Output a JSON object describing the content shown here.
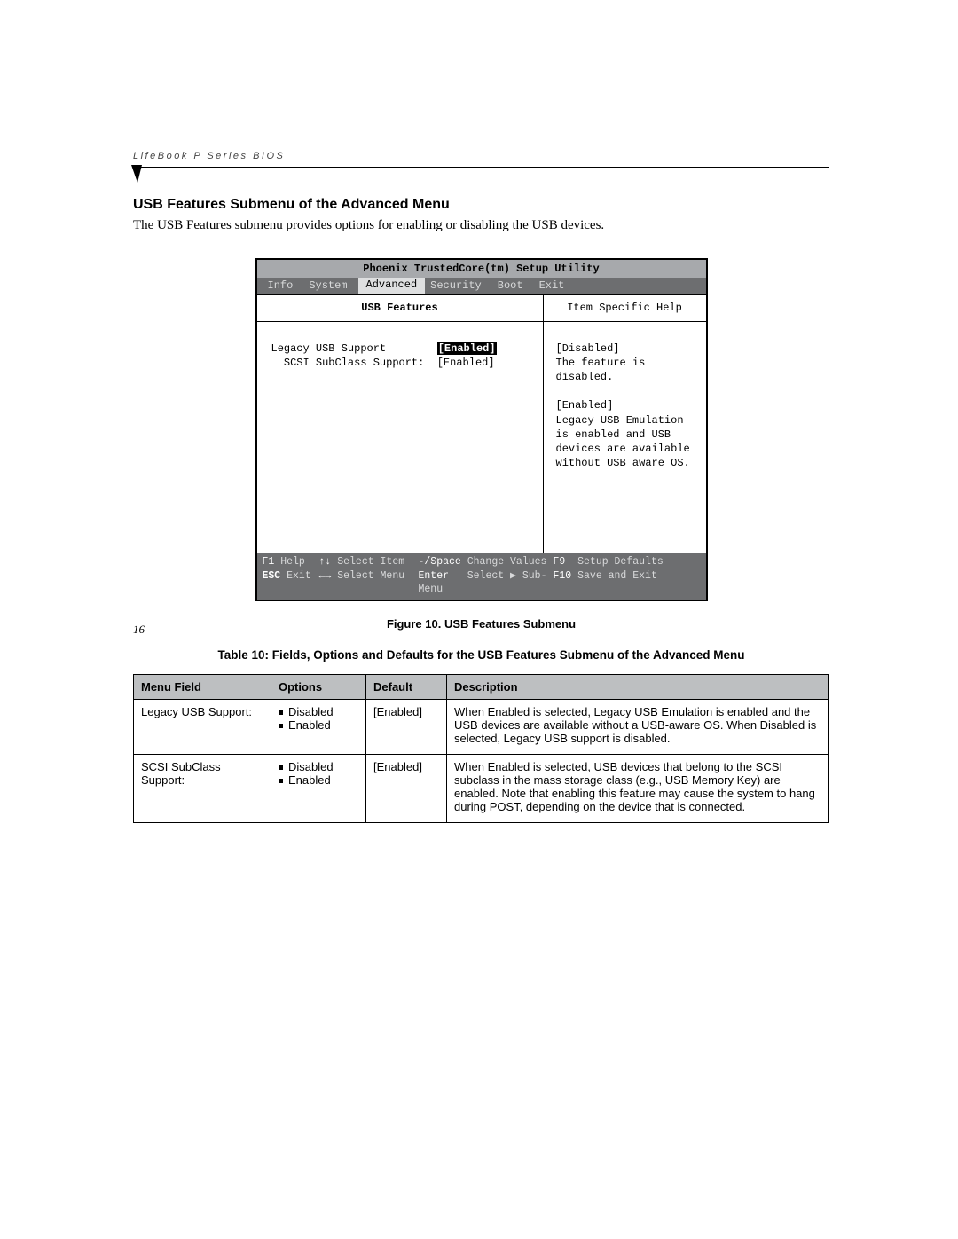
{
  "running_head": "LifeBook P Series BIOS",
  "section_title": "USB Features Submenu of the Advanced Menu",
  "intro": "The USB Features submenu provides options for enabling or disabling the USB devices.",
  "bios": {
    "title": "Phoenix TrustedCore(tm) Setup Utility",
    "menu": {
      "items": [
        "Info",
        "System",
        "Advanced",
        "Security",
        "Boot",
        "Exit"
      ],
      "active": "Advanced"
    },
    "left": {
      "title": "USB Features",
      "rows": [
        {
          "label": "Legacy USB Support",
          "value": "[Enabled]",
          "selected": true,
          "indent": 0
        },
        {
          "label": "SCSI SubClass Support:",
          "value": "[Enabled]",
          "selected": false,
          "indent": 2
        }
      ]
    },
    "right": {
      "title": "Item Specific Help",
      "blocks": [
        "[Disabled]",
        "The feature is disabled.",
        "",
        "[Enabled]",
        "Legacy USB Emulation",
        "is enabled and USB",
        "devices are available",
        "without USB aware OS."
      ]
    },
    "footer": {
      "r1": {
        "k1": "F1",
        "t1": "Help",
        "k2": "↑↓",
        "t2": "Select Item",
        "k3": "-/Space",
        "t3": "Change Values",
        "k4": "F9",
        "t4": "Setup Defaults"
      },
      "r2": {
        "k1": "ESC",
        "t1": "Exit",
        "k2": "←→",
        "t2": "Select Menu",
        "k3": "Enter",
        "t3": "Select ▶ Sub-Menu",
        "k4": "F10",
        "t4": "Save and Exit"
      }
    }
  },
  "figure_caption": "Figure 10.  USB Features Submenu",
  "table_caption": "Table 10: Fields, Options and Defaults for the USB Features Submenu of the Advanced Menu",
  "table": {
    "headers": [
      "Menu Field",
      "Options",
      "Default",
      "Description"
    ],
    "rows": [
      {
        "field": "Legacy USB Support:",
        "options": [
          "Disabled",
          "Enabled"
        ],
        "default": "[Enabled]",
        "desc": "When Enabled is selected, Legacy USB Emulation is enabled and the USB devices are available without a USB-aware OS. When Disabled is selected, Legacy USB support is disabled."
      },
      {
        "field": "SCSI SubClass Support:",
        "options": [
          "Disabled",
          "Enabled"
        ],
        "default": "[Enabled]",
        "desc": "When Enabled is selected, USB devices that belong to the SCSI subclass in the mass storage class (e.g., USB Memory Key) are enabled. Note that enabling this feature may cause the system to hang during POST, depending on the device that is connected."
      }
    ]
  },
  "page_number": "16"
}
